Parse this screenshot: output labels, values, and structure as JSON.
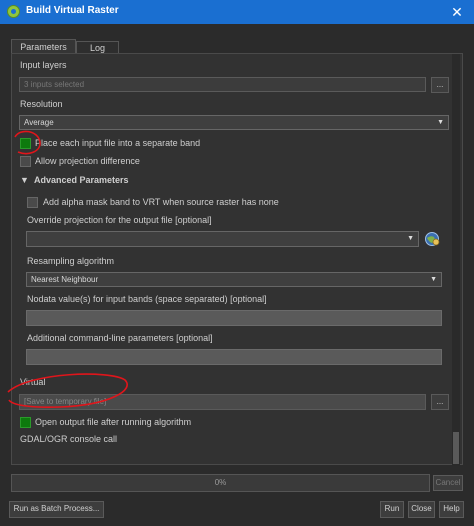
{
  "window": {
    "title": "Build Virtual Raster",
    "close_label": "✕",
    "accent": "#1a6fd1"
  },
  "tabs": [
    {
      "label": "Parameters"
    },
    {
      "label": "Log"
    }
  ],
  "form": {
    "input_layers_label": "Input layers",
    "input_layers_value": "3 inputs selected",
    "browse_label": "...",
    "resolution_label": "Resolution",
    "resolution_value": "Average",
    "separate_band_label": "Place each input file into a separate band",
    "separate_band_checked": true,
    "projection_diff_label": "Allow projection difference",
    "projection_diff_checked": false,
    "advanced_header": "Advanced Parameters",
    "alpha_mask_label": "Add alpha mask band to VRT when source raster has none",
    "alpha_mask_checked": false,
    "override_proj_label": "Override projection for the output file [optional]",
    "resampling_label": "Resampling algorithm",
    "resampling_value": "Nearest Neighbour",
    "nodata_label": "Nodata value(s) for input bands (space separated) [optional]",
    "cmdline_label": "Additional command-line parameters [optional]",
    "virtual_label": "Virtual",
    "virtual_placeholder": "[Save to temporary file]",
    "virtual_browse_label": "...",
    "open_output_label": "Open output file after running algorithm",
    "open_output_checked": true,
    "console_label": "GDAL/OGR console call"
  },
  "progress": {
    "text": "0%",
    "value": 0,
    "cancel_label": "Cancel"
  },
  "footer": {
    "batch_label": "Run as Batch Process...",
    "run_label": "Run",
    "close_label": "Close",
    "help_label": "Help"
  },
  "colors": {
    "annotation": "#e0151b",
    "checked": "#0d7a0d"
  }
}
